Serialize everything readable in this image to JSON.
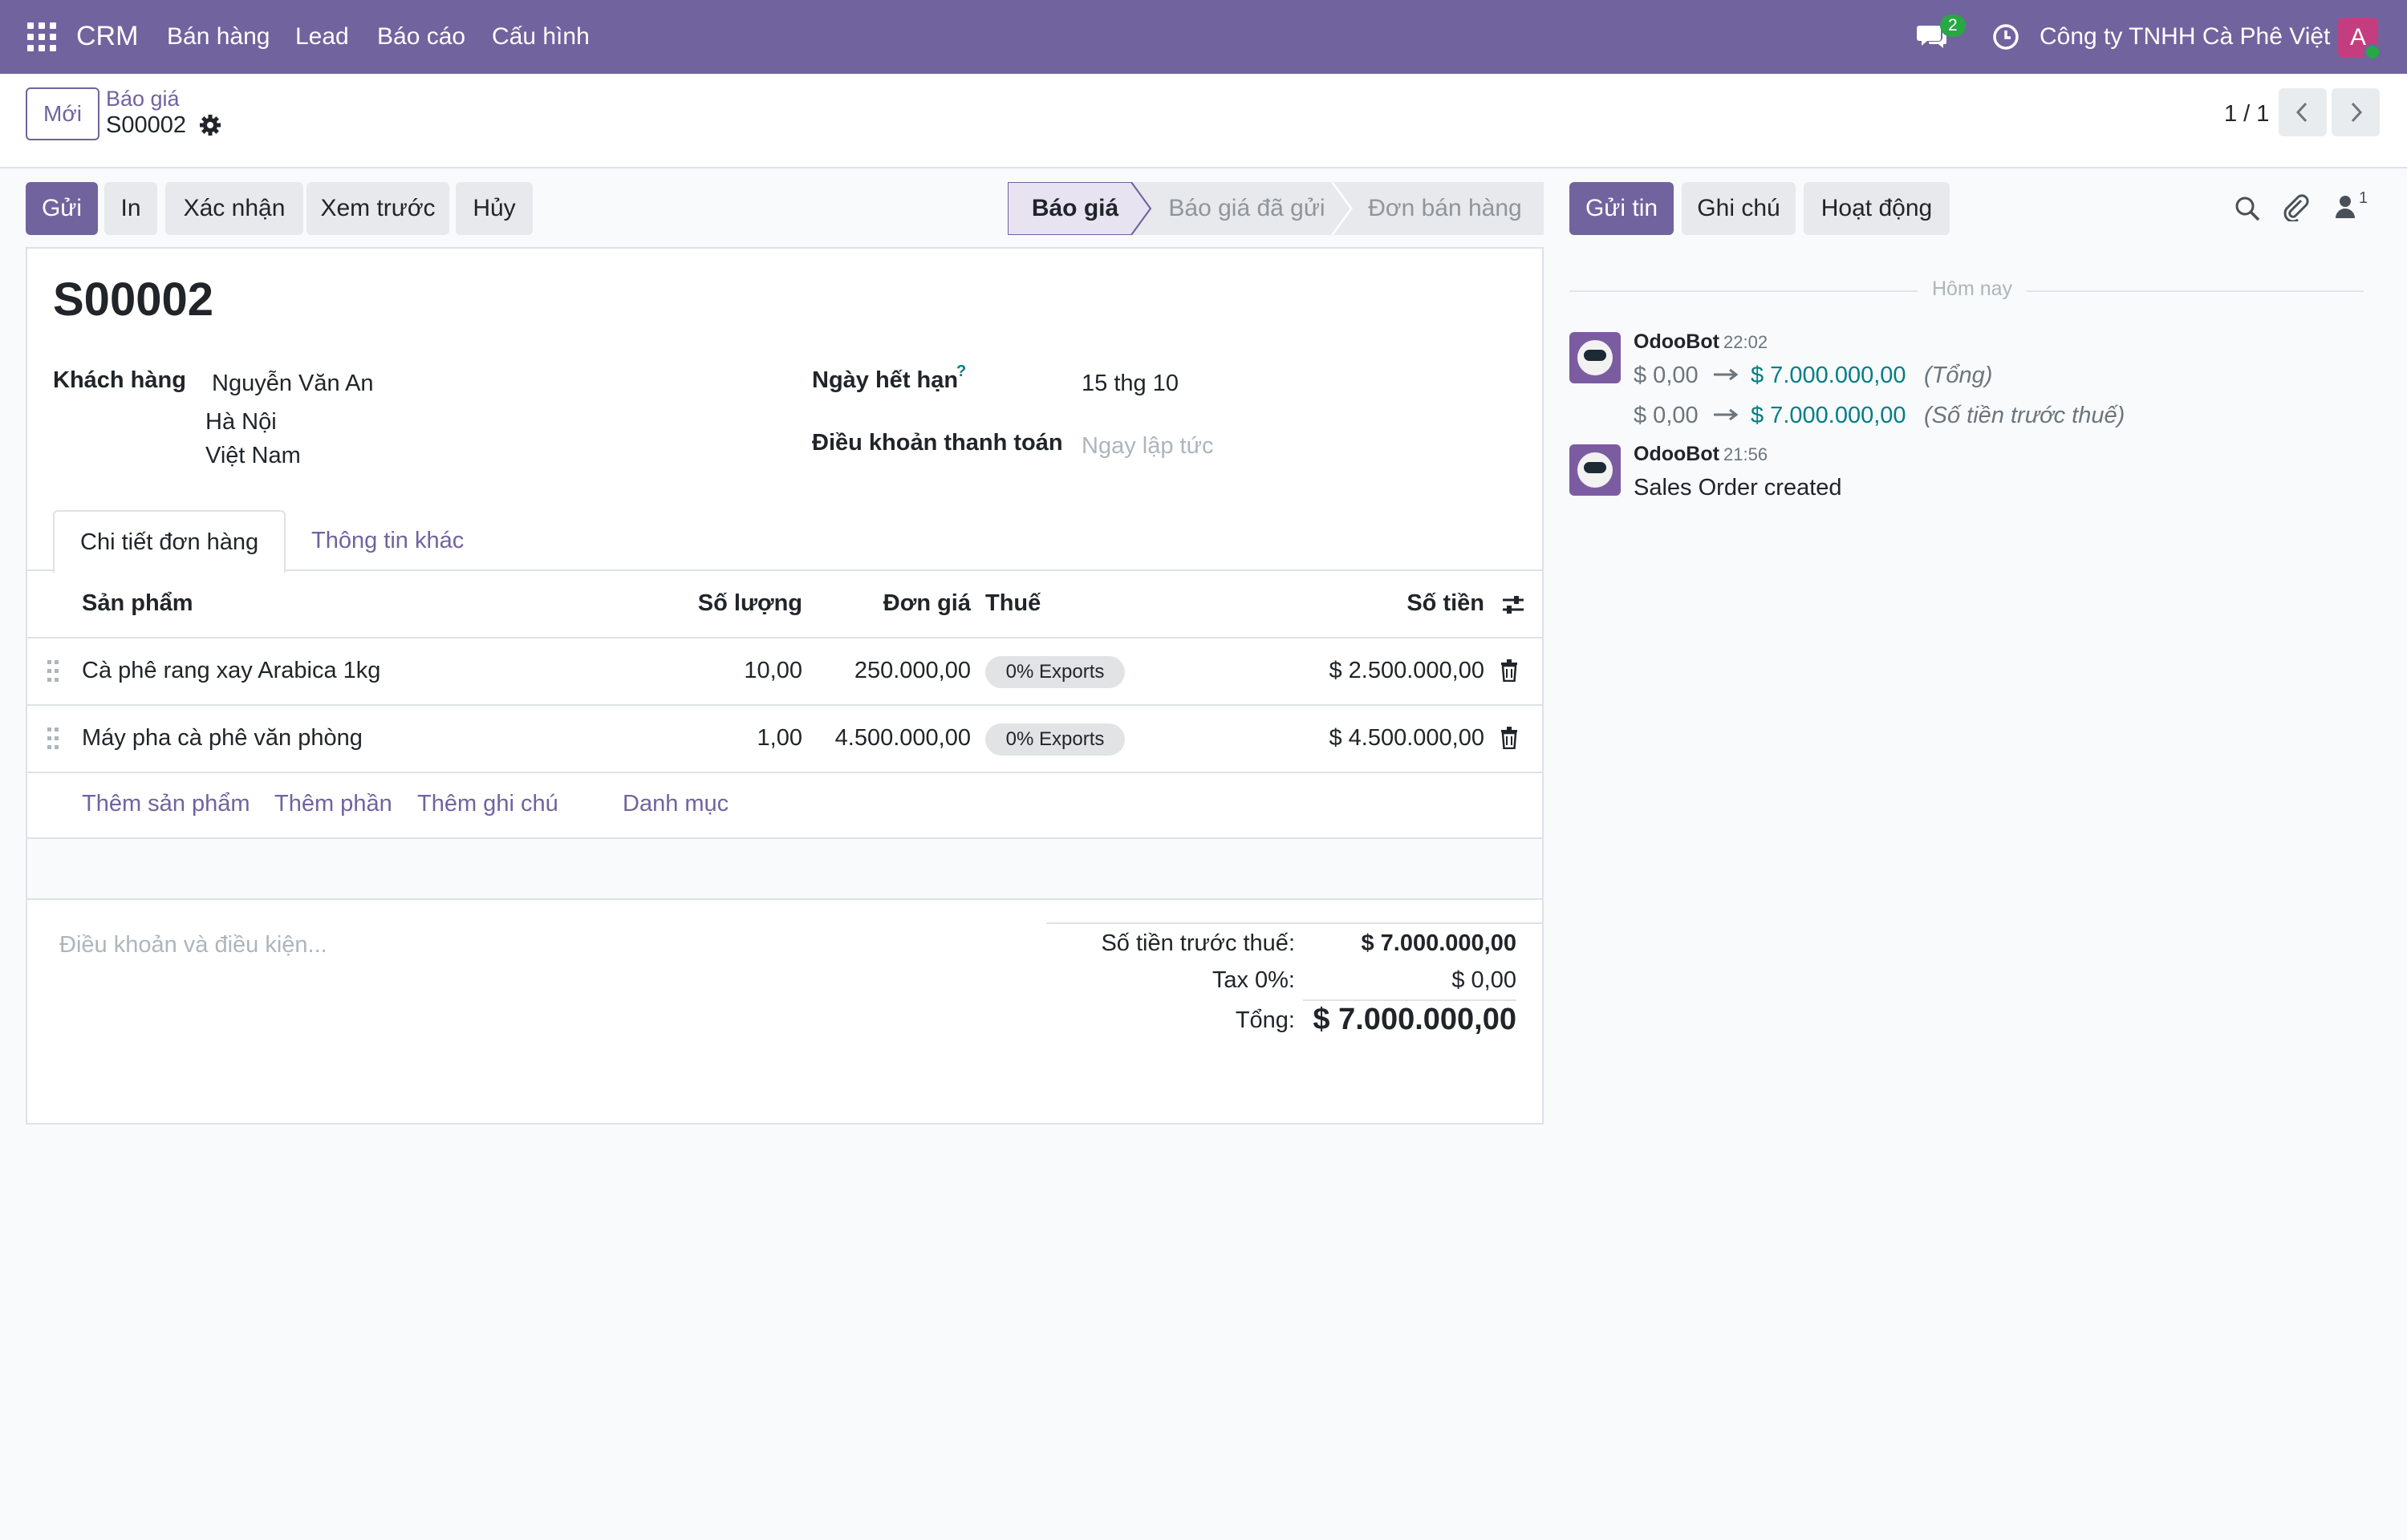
{
  "navbar": {
    "brand": "CRM",
    "menu": [
      "Bán hàng",
      "Lead",
      "Báo cáo",
      "Cấu hình"
    ],
    "chat_count": "2",
    "company": "Công ty TNHH Cà Phê Việt",
    "avatar_letter": "A"
  },
  "control": {
    "new_label": "Mới",
    "breadcrumb_parent": "Báo giá",
    "breadcrumb_current": "S00002",
    "pager": "1 / 1"
  },
  "actions": [
    "Gửi",
    "In",
    "Xác nhận",
    "Xem trước",
    "Hủy"
  ],
  "status_steps": [
    "Báo giá",
    "Báo giá đã gửi",
    "Đơn bán hàng"
  ],
  "form": {
    "title": "S00002",
    "customer_label": "Khách hàng",
    "customer_name": "Nguyễn Văn An",
    "customer_city": "Hà Nội",
    "customer_country": "Việt Nam",
    "expiry_label": "Ngày hết hạn",
    "expiry_help": "?",
    "expiry_value": "15 thg 10",
    "payment_terms_label": "Điều khoản thanh toán",
    "payment_terms_placeholder": "Ngay lập tức",
    "tabs": [
      "Chi tiết đơn hàng",
      "Thông tin khác"
    ],
    "columns": {
      "product": "Sản phẩm",
      "quantity": "Số lượng",
      "unit_price": "Đơn giá",
      "tax": "Thuế",
      "amount": "Số tiền"
    },
    "lines": [
      {
        "product": "Cà phê rang xay Arabica 1kg",
        "quantity": "10,00",
        "unit_price": "250.000,00",
        "tax": "0% Exports",
        "amount": "$ 2.500.000,00"
      },
      {
        "product": "Máy pha cà phê văn phòng",
        "quantity": "1,00",
        "unit_price": "4.500.000,00",
        "tax": "0% Exports",
        "amount": "$ 4.500.000,00"
      }
    ],
    "add_links": [
      "Thêm sản phẩm",
      "Thêm phần",
      "Thêm ghi chú",
      "Danh mục"
    ],
    "terms_placeholder": "Điều khoản và điều kiện...",
    "totals": {
      "untaxed_label": "Số tiền trước thuế:",
      "untaxed_value": "$ 7.000.000,00",
      "tax_label": "Tax 0%:",
      "tax_value": "$ 0,00",
      "total_label": "Tổng:",
      "total_value": "$ 7.000.000,00"
    }
  },
  "chatter": {
    "buttons": [
      "Gửi tin",
      "Ghi chú",
      "Hoạt động"
    ],
    "follower_count": "1",
    "date_separator": "Hôm nay",
    "messages": [
      {
        "author": "OdooBot",
        "time": "22:02",
        "changes": [
          {
            "old": "$ 0,00",
            "new": "$ 7.000.000,00",
            "field": "(Tổng)"
          },
          {
            "old": "$ 0,00",
            "new": "$ 7.000.000,00",
            "field": "(Số tiền trước thuế)"
          }
        ]
      },
      {
        "author": "OdooBot",
        "time": "21:56",
        "body": "Sales Order created"
      }
    ]
  }
}
